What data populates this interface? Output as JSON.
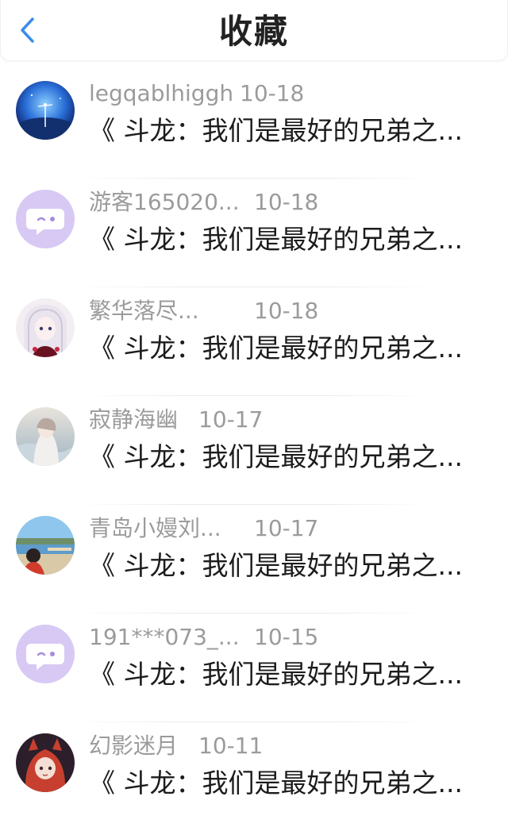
{
  "header": {
    "title": "收藏",
    "back_icon": "chevron-left-icon",
    "accent_color": "#3a8ee6"
  },
  "items": [
    {
      "username": "legqablhiggh",
      "date": "10-18",
      "content": "《 斗龙：我们是最好的兄弟之...",
      "avatar_icon": "sky-landscape-avatar"
    },
    {
      "username": "游客165020...",
      "date": "10-18",
      "content": "《 斗龙：我们是最好的兄弟之...",
      "avatar_icon": "chat-bubble-avatar"
    },
    {
      "username": "繁华落尽...",
      "date": "10-18",
      "content": "《 斗龙：我们是最好的兄弟之...",
      "avatar_icon": "anime-girl-avatar"
    },
    {
      "username": "寂静海幽",
      "date": "10-17",
      "content": "《 斗龙：我们是最好的兄弟之...",
      "avatar_icon": "anime-girl-avatar"
    },
    {
      "username": "青岛小嫚刘...",
      "date": "10-17",
      "content": "《 斗龙：我们是最好的兄弟之...",
      "avatar_icon": "beach-photo-avatar"
    },
    {
      "username": "191***073_...",
      "date": "10-15",
      "content": "《 斗龙：我们是最好的兄弟之...",
      "avatar_icon": "chat-bubble-avatar"
    },
    {
      "username": "幻影迷月",
      "date": "10-11",
      "content": "《 斗龙：我们是最好的兄弟之...",
      "avatar_icon": "anime-girl-avatar"
    }
  ]
}
